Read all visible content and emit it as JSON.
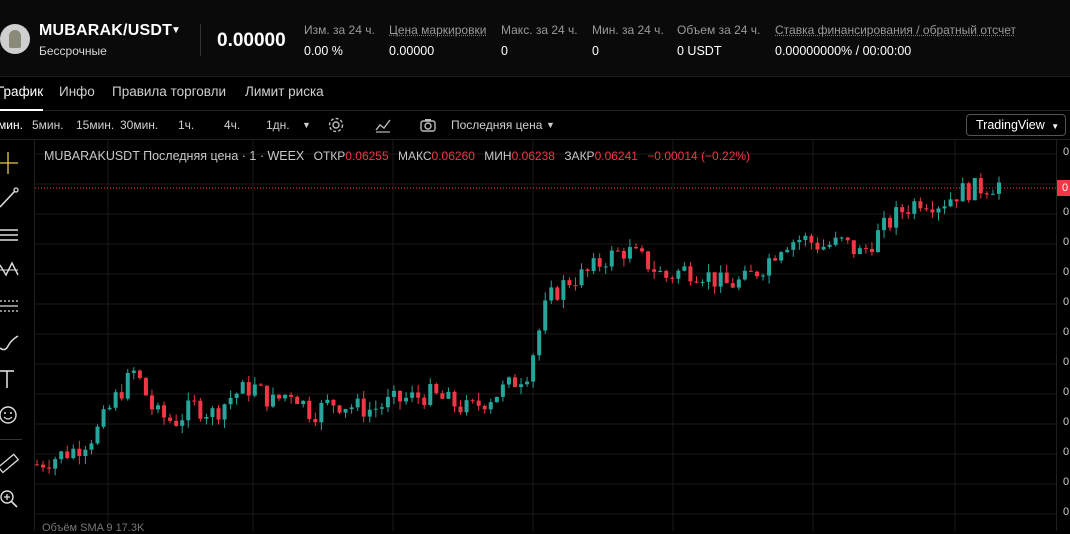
{
  "header": {
    "symbol": "MUBARAK/USDT",
    "market_type": "Бессрочные",
    "last_price": "0.00000",
    "stats": [
      {
        "label": "Изм. за 24 ч.",
        "value": "0.00 %"
      },
      {
        "label": "Цена маркировки",
        "value": "0.00000"
      },
      {
        "label": "Макс. за 24 ч.",
        "value": "0"
      },
      {
        "label": "Мин. за 24 ч.",
        "value": "0"
      },
      {
        "label": "Объем за 24 ч.",
        "value": "0 USDT"
      },
      {
        "label": "Ставка финансирования / обратный отсчет",
        "value": "0.00000000% / 00:00:00"
      }
    ]
  },
  "tabs": [
    "График",
    "Инфо",
    "Правила торговли",
    "Лимит риска"
  ],
  "toolbar": {
    "intervals": [
      "мин.",
      "5мин.",
      "15мин.",
      "30мин.",
      "1ч.",
      "4ч.",
      "1дн."
    ],
    "price_type": "Последняя цена",
    "chart_lib": "TradingView"
  },
  "sidebar_tools": [
    "crosshair-icon",
    "trend-line-icon",
    "horizontal-lines-icon",
    "pattern-icon",
    "fib-icon",
    "brush-icon",
    "text-icon",
    "emoji-icon",
    "ruler-icon",
    "zoom-in-icon"
  ],
  "legend": {
    "title": "MUBARAKUSDT Последняя цена · 1 · WEEX",
    "o_label": "ОТКР",
    "o": "0.06255",
    "h_label": "МАКС",
    "h": "0.06260",
    "l_label": "МИН",
    "l": "0.06238",
    "c_label": "ЗАКР",
    "c": "0.06241",
    "change": "−0.00014 (−0.22%)"
  },
  "price_axis": {
    "tick_text": "0",
    "current_label": "0"
  },
  "volume_label": "Объём SMA 9 17.3K",
  "colors": {
    "up": "#26a69a",
    "down": "#f23645",
    "bg": "#000000",
    "grid": "#1a1a1a"
  },
  "chart_data": {
    "type": "candlestick",
    "symbol": "MUBARAKUSDT",
    "interval": "1",
    "last": {
      "open": 0.06255,
      "high": 0.0626,
      "low": 0.06238,
      "close": 0.06241
    },
    "trend_closes": [
      0.0554,
      0.0556,
      0.0558,
      0.0562,
      0.0571,
      0.0578,
      0.0567,
      0.0565,
      0.0569,
      0.0567,
      0.0572,
      0.0574,
      0.057,
      0.0573,
      0.0567,
      0.057,
      0.0569,
      0.0568,
      0.057,
      0.0571,
      0.0572,
      0.057,
      0.0568,
      0.0571,
      0.0574,
      0.0578,
      0.0596,
      0.0601,
      0.0603,
      0.0607,
      0.0609,
      0.0606,
      0.0602,
      0.0604,
      0.0603,
      0.06,
      0.0601,
      0.0605,
      0.0611,
      0.0612,
      0.061,
      0.0611,
      0.0608,
      0.0614,
      0.0619,
      0.0622,
      0.0621,
      0.0624,
      0.0625,
      0.0626
    ]
  }
}
